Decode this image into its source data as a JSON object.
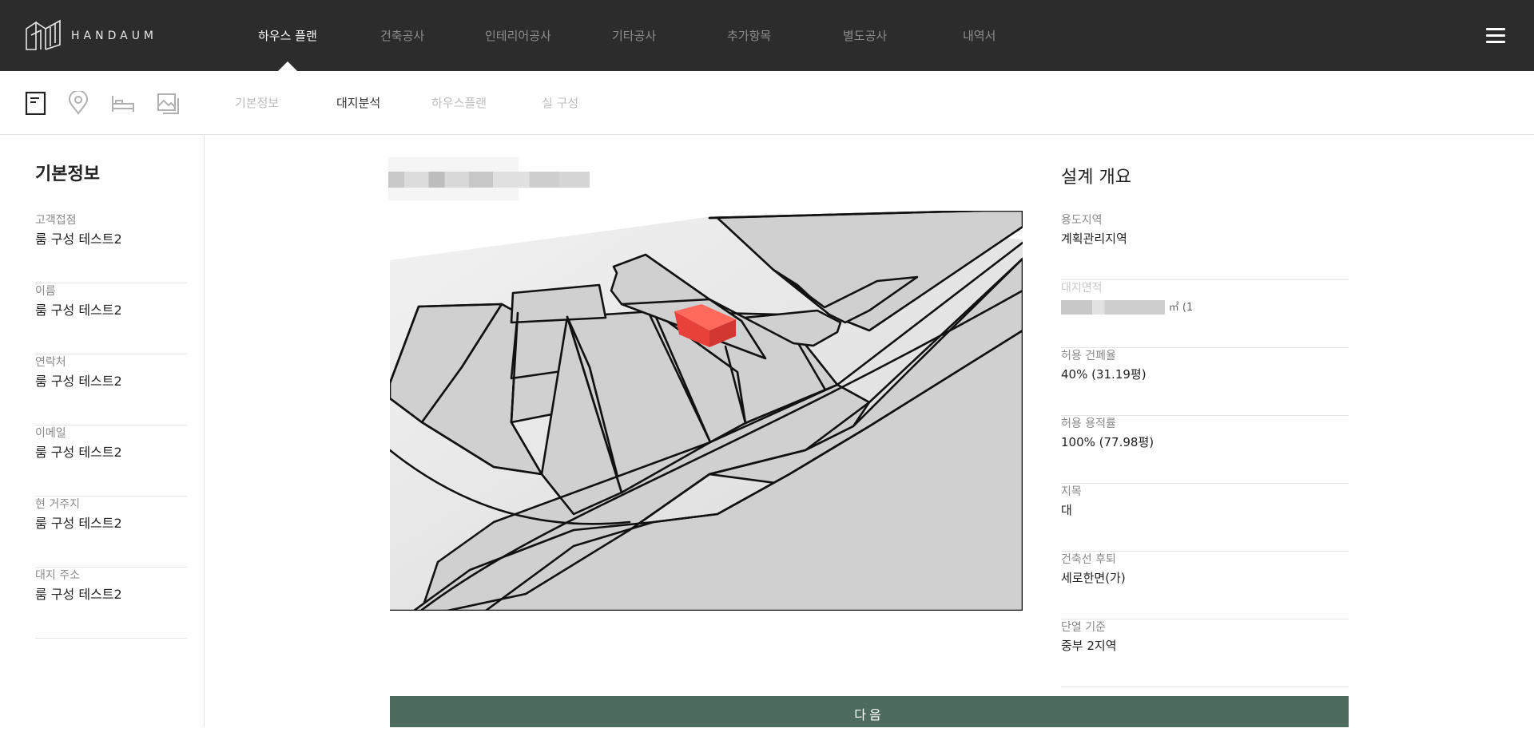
{
  "brand": {
    "name": "HANDAUM",
    "logo_icon": "handaum-logo-icon"
  },
  "nav": {
    "items": [
      {
        "label": "하우스 플랜",
        "active": true
      },
      {
        "label": "건축공사",
        "active": false
      },
      {
        "label": "인테리어공사",
        "active": false
      },
      {
        "label": "기타공사",
        "active": false
      },
      {
        "label": "추가항목",
        "active": false
      },
      {
        "label": "별도공사",
        "active": false
      },
      {
        "label": "내역서",
        "active": false
      }
    ],
    "menu_icon": "hamburger-icon"
  },
  "subnav": {
    "icons": [
      "document-icon",
      "location-pin-icon",
      "bed-icon",
      "image-icon"
    ],
    "tabs": [
      {
        "label": "기본정보",
        "active": false
      },
      {
        "label": "대지분석",
        "active": true
      },
      {
        "label": "하우스플랜",
        "active": false
      },
      {
        "label": "실 구성",
        "active": false
      }
    ]
  },
  "sidebar": {
    "title": "기본정보",
    "items": [
      {
        "label": "고객접점",
        "value": "룸 구성 테스트2"
      },
      {
        "label": "이름",
        "value": "룸 구성 테스트2"
      },
      {
        "label": "연락처",
        "value": "룸 구성 테스트2"
      },
      {
        "label": "이메일",
        "value": "룸 구성 테스트2"
      },
      {
        "label": "현 거주지",
        "value": "룸 구성 테스트2"
      },
      {
        "label": "대지 주소",
        "value": "룸 구성 테스트2"
      }
    ]
  },
  "design_summary": {
    "title": "설계 개요",
    "items": [
      {
        "label": "용도지역",
        "value": "계획관리지역"
      },
      {
        "label": "대지면적",
        "value": "㎡ (1"
      },
      {
        "label": "허용 건폐율",
        "value": "40% (31.19평)"
      },
      {
        "label": "허용 용적률",
        "value": "100% (77.98평)"
      },
      {
        "label": "지목",
        "value": "대"
      },
      {
        "label": "건축선 후퇴",
        "value": "세로한면(가)"
      },
      {
        "label": "단열 기준",
        "value": "중부 2지역"
      }
    ]
  },
  "map": {
    "building_color": "#e8403a",
    "parcel_color": "#d0d0d0"
  },
  "next_button": {
    "label": "다음"
  },
  "colors": {
    "topbar": "#2c2c2c",
    "accent": "#4d6c5f"
  }
}
